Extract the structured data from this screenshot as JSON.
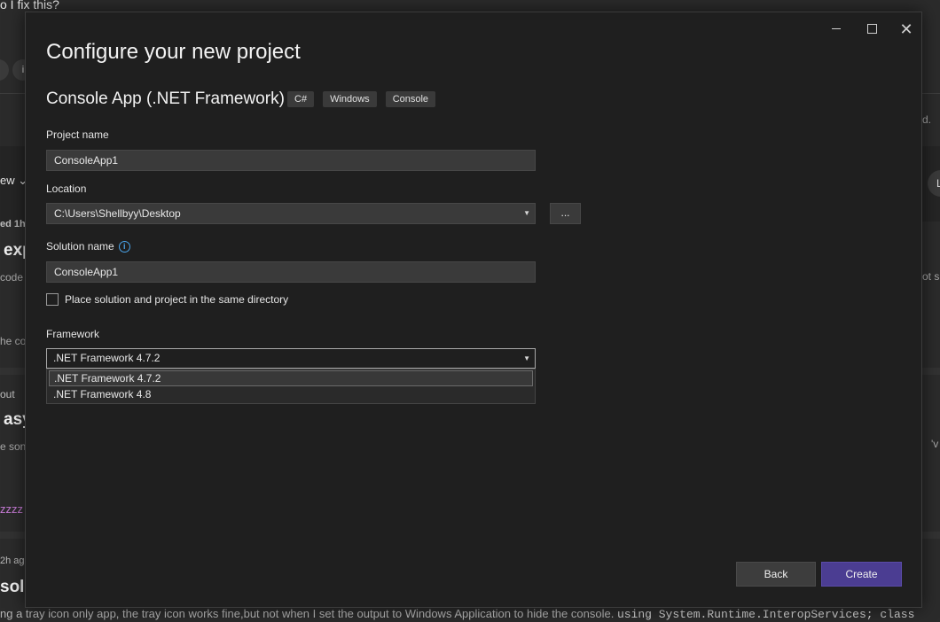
{
  "background_page": {
    "top_question": "o I fix this?",
    "pill_label": "i",
    "sort_label": "ew",
    "post1_meta": "ed 1h",
    "post1_title": "exp",
    "post1_excerpt": "code",
    "post1_more": "he co",
    "post2_meta": "out",
    "post2_title": "asy",
    "post2_excerpt": "e son",
    "post2_tag": "zzzz",
    "post3_meta": "2h ag",
    "post3_title": "sol",
    "post3_excerpt_text": "ng a tray icon only app, the tray icon works fine,but not when I set the output to Windows Application to hide the console.",
    "post3_excerpt_code": "using System.Runtime.InteropServices; class",
    "right_fragment_1": "d.",
    "right_fragment_2": "ot s",
    "right_fragment_3": "L",
    "right_fragment_4": "'v"
  },
  "window_controls": {
    "minimize_icon": "minimize-icon",
    "maximize_icon": "maximize-icon",
    "close_label": "✕"
  },
  "dialog": {
    "heading": "Configure your new project",
    "template_name": "Console App (.NET Framework)",
    "tags": [
      "C#",
      "Windows",
      "Console"
    ],
    "project_name": {
      "label": "Project name",
      "value": "ConsoleApp1"
    },
    "location": {
      "label": "Location",
      "value": "C:\\Users\\Shellbyy\\Desktop",
      "browse_label": "..."
    },
    "solution_name": {
      "label": "Solution name",
      "value": "ConsoleApp1",
      "info_glyph": "i"
    },
    "same_directory": {
      "label": "Place solution and project in the same directory",
      "checked": false
    },
    "framework": {
      "label": "Framework",
      "selected": ".NET Framework 4.7.2",
      "options": [
        ".NET Framework 4.7.2",
        ".NET Framework 4.8"
      ],
      "caret": "▼"
    },
    "buttons": {
      "back": "Back",
      "create": "Create"
    }
  }
}
